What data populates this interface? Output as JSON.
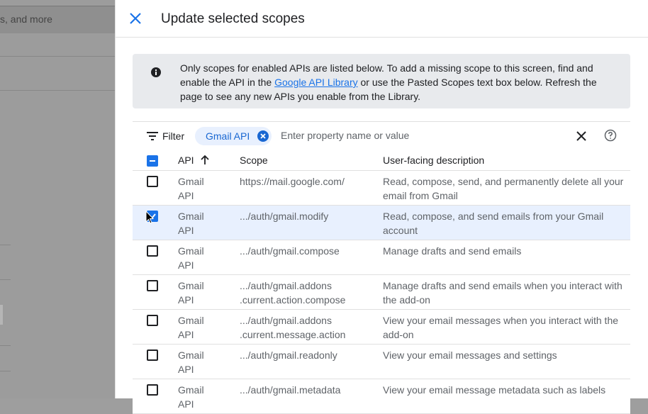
{
  "background": {
    "topbar_text": "s, and more"
  },
  "dialog": {
    "title": "Update selected scopes",
    "info": {
      "text_before_link": "Only scopes for enabled APIs are listed below. To add a missing scope to this screen, find and enable the API in the ",
      "link_text": "Google API Library",
      "text_after_link": " or use the Pasted Scopes text box below. Refresh the page to see any new APIs you enable from the Library."
    },
    "filter": {
      "label": "Filter",
      "chip_label": "Gmail API",
      "placeholder": "Enter property name or value"
    },
    "table": {
      "headers": {
        "api": "API",
        "scope": "Scope",
        "description": "User-facing description"
      },
      "rows": [
        {
          "api_line1": "Gmail",
          "api_line2": "API",
          "scope_line1": "https://mail.google.com/",
          "scope_line2": "",
          "description": "Read, compose, send, and permanently delete all your email from Gmail",
          "checked": false
        },
        {
          "api_line1": "Gmail",
          "api_line2": "API",
          "scope_line1": ".../auth/gmail.modify",
          "scope_line2": "",
          "description": "Read, compose, and send emails from your Gmail account",
          "checked": true
        },
        {
          "api_line1": "Gmail",
          "api_line2": "API",
          "scope_line1": ".../auth/gmail.compose",
          "scope_line2": "",
          "description": "Manage drafts and send emails",
          "checked": false
        },
        {
          "api_line1": "Gmail",
          "api_line2": "API",
          "scope_line1": ".../auth/gmail.addons",
          "scope_line2": ".current.action.compose",
          "description": "Manage drafts and send emails when you interact with the add-on",
          "checked": false
        },
        {
          "api_line1": "Gmail",
          "api_line2": "API",
          "scope_line1": ".../auth/gmail.addons",
          "scope_line2": ".current.message.action",
          "description": "View your email messages when you interact with the add-on",
          "checked": false
        },
        {
          "api_line1": "Gmail",
          "api_line2": "API",
          "scope_line1": ".../auth/gmail.readonly",
          "scope_line2": "",
          "description": "View your email messages and settings",
          "checked": false
        },
        {
          "api_line1": "Gmail",
          "api_line2": "API",
          "scope_line1": ".../auth/gmail.metadata",
          "scope_line2": "",
          "description": "View your email message metadata such as labels",
          "checked": false
        }
      ]
    }
  },
  "colors": {
    "accent": "#1a73e8",
    "selected_row": "#e8f0fe",
    "chip_bg": "#e8f0fe",
    "info_bg": "#e8eaed"
  }
}
